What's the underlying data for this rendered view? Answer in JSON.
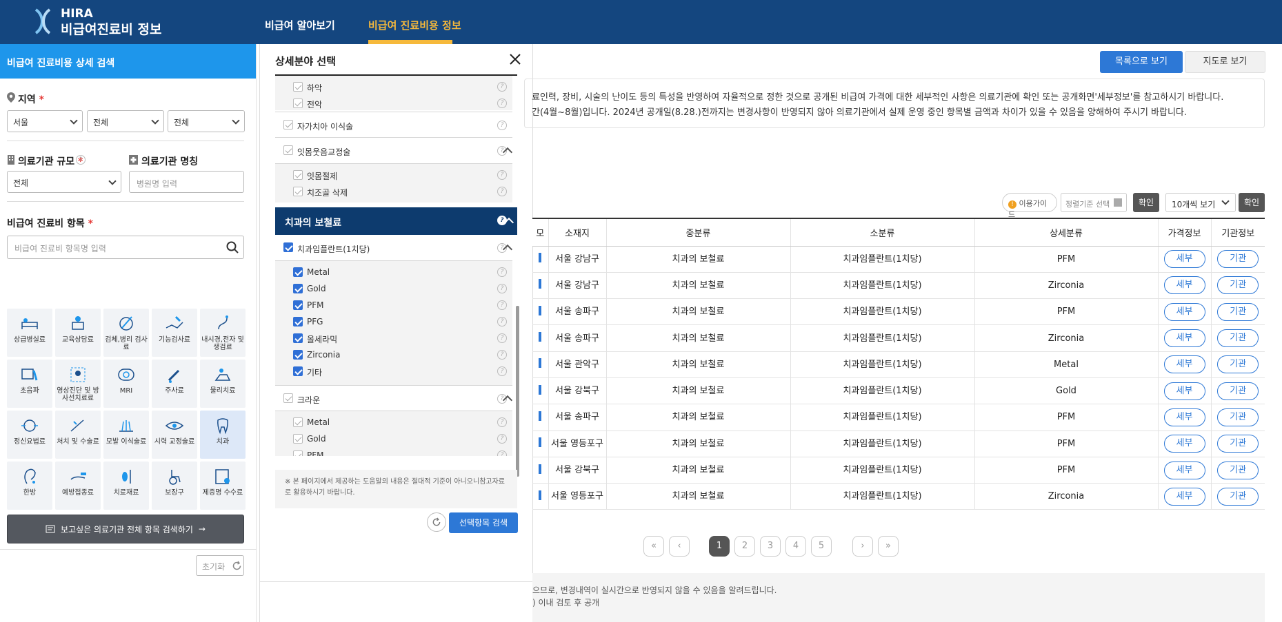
{
  "header": {
    "logo_top": "HIRA",
    "logo_bottom": "비급여진료비 정보",
    "nav": [
      "비급여 알아보기",
      "비급여 진료비용 정보"
    ],
    "active_color": "#f6b93b",
    "bg_color": "#14467f"
  },
  "left": {
    "title": "비급여 진료비용 상세 검색",
    "region_label": "지역",
    "region_selects": [
      "서울",
      "전체",
      "전체"
    ],
    "scale_label": "의료기관 규모",
    "scale_value": "전체",
    "name_label": "의료기관 명칭",
    "name_placeholder": "병원명 입력",
    "item_label": "비급여 진료비 항목",
    "item_placeholder": "비급여 진료비 항목명 입력",
    "categories": [
      {
        "label": "상급병실료",
        "icon": "bed-icon"
      },
      {
        "label": "교육상담료",
        "icon": "counsel-icon"
      },
      {
        "label": "검체,병리 검사료",
        "icon": "lab-icon"
      },
      {
        "label": "기능검사료",
        "icon": "function-test-icon"
      },
      {
        "label": "내시경,전자 및 생검료",
        "icon": "endoscope-icon"
      },
      {
        "label": "초음파",
        "icon": "ultrasound-icon"
      },
      {
        "label": "영상진단 및 방사선치료료",
        "icon": "imaging-icon"
      },
      {
        "label": "MRI",
        "icon": "mri-icon"
      },
      {
        "label": "주사료",
        "icon": "syringe-icon"
      },
      {
        "label": "물리치료",
        "icon": "physio-icon"
      },
      {
        "label": "정신요법료",
        "icon": "brain-icon"
      },
      {
        "label": "처치 및 수술료",
        "icon": "surgery-icon"
      },
      {
        "label": "모발 이식술료",
        "icon": "hair-icon"
      },
      {
        "label": "시력 교정술료",
        "icon": "eye-icon"
      },
      {
        "label": "치과",
        "icon": "tooth-icon"
      },
      {
        "label": "한방",
        "icon": "ear-icon"
      },
      {
        "label": "예방접종료",
        "icon": "vaccine-icon"
      },
      {
        "label": "치료재료",
        "icon": "material-icon"
      },
      {
        "label": "보장구",
        "icon": "wheelchair-icon"
      },
      {
        "label": "제증명 수수료",
        "icon": "certificate-icon"
      }
    ],
    "search_all_label": "보고싶은 의료기관 전체 항목 검색하기",
    "reset_label": "초기화"
  },
  "modal": {
    "title": "상세분야 선택",
    "rows_top": [
      {
        "label": "하악",
        "type": "child"
      },
      {
        "label": "전악",
        "type": "child"
      },
      {
        "label": "자가치아 이식술",
        "type": "parent"
      },
      {
        "label": "잇몸웃음교정술",
        "type": "parent-open"
      },
      {
        "label": "잇몸절제",
        "type": "child"
      },
      {
        "label": "치조골 삭제",
        "type": "child"
      }
    ],
    "section_title": "치과의 보철료",
    "implant_parent": "치과임플란트(1치당)",
    "implant_children": [
      "Metal",
      "Gold",
      "PFM",
      "PFG",
      "올세라믹",
      "Zirconia",
      "기타"
    ],
    "crown_parent": "크라운",
    "crown_children": [
      "Metal",
      "Gold",
      "PFM"
    ],
    "note": "※ 본 페이지에서 제공하는 도움말의 내용은 절대적 기준이 아니오니참고자료로 활용하시기 바랍니다.",
    "search_label": "선택항목 검색"
  },
  "main": {
    "list_view_label": "목록으로 보기",
    "map_view_label": "지도로 보기",
    "notice_lines": [
      "료인력, 장비, 시술의 난이도 등의 특성을 반영하여 자율적으로 정한 것으로 공개된 비급여 가격에 대한 세부적인 사항은 의료기관에 확인 또는 공개화면'세부정보'를 참고하시기 바랍니다.",
      "간(4월~8월)입니다. 2024년 공개일(8.28.)전까지는 변경사항이 반영되지 않아 의료기관에서 실제 운영 중인 항목별 금액과 차이가 있을 수 있음을 양해하여 주시기 바랍니다."
    ],
    "guide_label": "이용가이드",
    "sort_label": "정렬기준 선택",
    "confirm_label": "확인",
    "per_page_label": "10개씩 보기",
    "columns": [
      "모",
      "소재지",
      "중분류",
      "소분류",
      "상세분류",
      "가격정보",
      "기관정보"
    ],
    "detail_btn": "세부",
    "org_btn": "기관",
    "rows": [
      {
        "loc": "서울 강남구",
        "mid": "치과의 보철료",
        "sub": "치과임플란트(1치당)",
        "detail": "PFM"
      },
      {
        "loc": "서울 강남구",
        "mid": "치과의 보철료",
        "sub": "치과임플란트(1치당)",
        "detail": "Zirconia"
      },
      {
        "loc": "서울 송파구",
        "mid": "치과의 보철료",
        "sub": "치과임플란트(1치당)",
        "detail": "PFM"
      },
      {
        "loc": "서울 송파구",
        "mid": "치과의 보철료",
        "sub": "치과임플란트(1치당)",
        "detail": "Zirconia"
      },
      {
        "loc": "서울 관악구",
        "mid": "치과의 보철료",
        "sub": "치과임플란트(1치당)",
        "detail": "Metal"
      },
      {
        "loc": "서울 강북구",
        "mid": "치과의 보철료",
        "sub": "치과임플란트(1치당)",
        "detail": "Gold"
      },
      {
        "loc": "서울 송파구",
        "mid": "치과의 보철료",
        "sub": "치과임플란트(1치당)",
        "detail": "PFM"
      },
      {
        "loc": "서울 영등포구",
        "mid": "치과의 보철료",
        "sub": "치과임플란트(1치당)",
        "detail": "PFM"
      },
      {
        "loc": "서울 강북구",
        "mid": "치과의 보철료",
        "sub": "치과임플란트(1치당)",
        "detail": "PFM"
      },
      {
        "loc": "서울 영등포구",
        "mid": "치과의 보철료",
        "sub": "치과임플란트(1치당)",
        "detail": "Zirconia"
      }
    ],
    "pages": [
      "1",
      "2",
      "3",
      "4",
      "5"
    ],
    "current_page": 1,
    "bottom_lines": [
      "으므로, 변경내역이 실시간으로 반영되지 않을 수 있음을 알려드립니다.",
      ") 이내 검토 후 공개"
    ]
  }
}
